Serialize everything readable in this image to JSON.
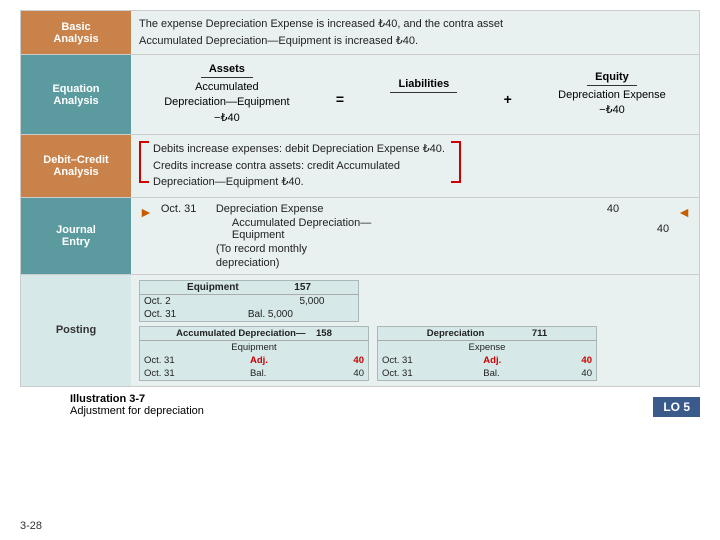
{
  "page": {
    "page_number": "3-28",
    "footer": {
      "illustration": "Illustration 3-7",
      "description": "Adjustment for depreciation",
      "lo_label": "LO 5"
    }
  },
  "sections": {
    "basic_analysis": {
      "label": "Basic\nAnalysis",
      "text_line1": "The expense Depreciation Expense is increased ₺40, and the contra asset",
      "text_line2": "Accumulated Depreciation—Equipment is increased ₺40."
    },
    "equation_analysis": {
      "label": "Equation\nAnalysis",
      "assets_header": "Assets",
      "liabilities_header": "Liabilities",
      "equity_header": "Equity",
      "assets_value_line1": "Accumulated",
      "assets_value_line2": "Depreciation—Equipment",
      "assets_value_line3": "−₺40",
      "liabilities_value": "=",
      "equity_value_line1": "Depreciation Expense",
      "equity_value_line2": "−₺40",
      "equals_sign": "=",
      "plus_sign": "+"
    },
    "debit_credit": {
      "label": "Debit–Credit\nAnalysis",
      "line1": "Debits increase expenses: debit Depreciation Expense ₺40.",
      "line2": "Credits increase contra assets: credit Accumulated",
      "line3": "Depreciation—Equipment ₺40."
    },
    "journal_entry": {
      "label": "Journal\nEntry",
      "date": "Oct. 31",
      "debit_account": "Depreciation Expense",
      "credit_account": "Accumulated Depreciation— Equipment",
      "note": "(To record monthly",
      "note2": "depreciation)",
      "debit_amount": "40",
      "credit_amount": "40"
    },
    "posting": {
      "label": "Posting",
      "equipment_table": {
        "title": "Equipment",
        "number": "157",
        "rows": [
          {
            "date": "Oct. 2",
            "amount": "5,000"
          },
          {
            "date": "Oct. 31",
            "label": "Bal.",
            "amount": "5,000"
          }
        ]
      },
      "accum_dep_table": {
        "title": "Accumulated Depreciation—\nEquipment",
        "number": "158",
        "rows": [
          {
            "date": "Oct. 31",
            "label": "Adj.",
            "amount": "40",
            "is_red": true
          },
          {
            "date": "Oct. 31",
            "label": "Bal.",
            "amount": "40"
          }
        ]
      },
      "dep_expense_table": {
        "title": "Depreciation\nExpense",
        "number": "711",
        "rows": [
          {
            "date": "Oct. 31",
            "label": "Adj.",
            "amount": "40",
            "is_red": true
          },
          {
            "date": "Oct. 31",
            "label": "Bal.",
            "amount": "40"
          }
        ]
      }
    }
  }
}
